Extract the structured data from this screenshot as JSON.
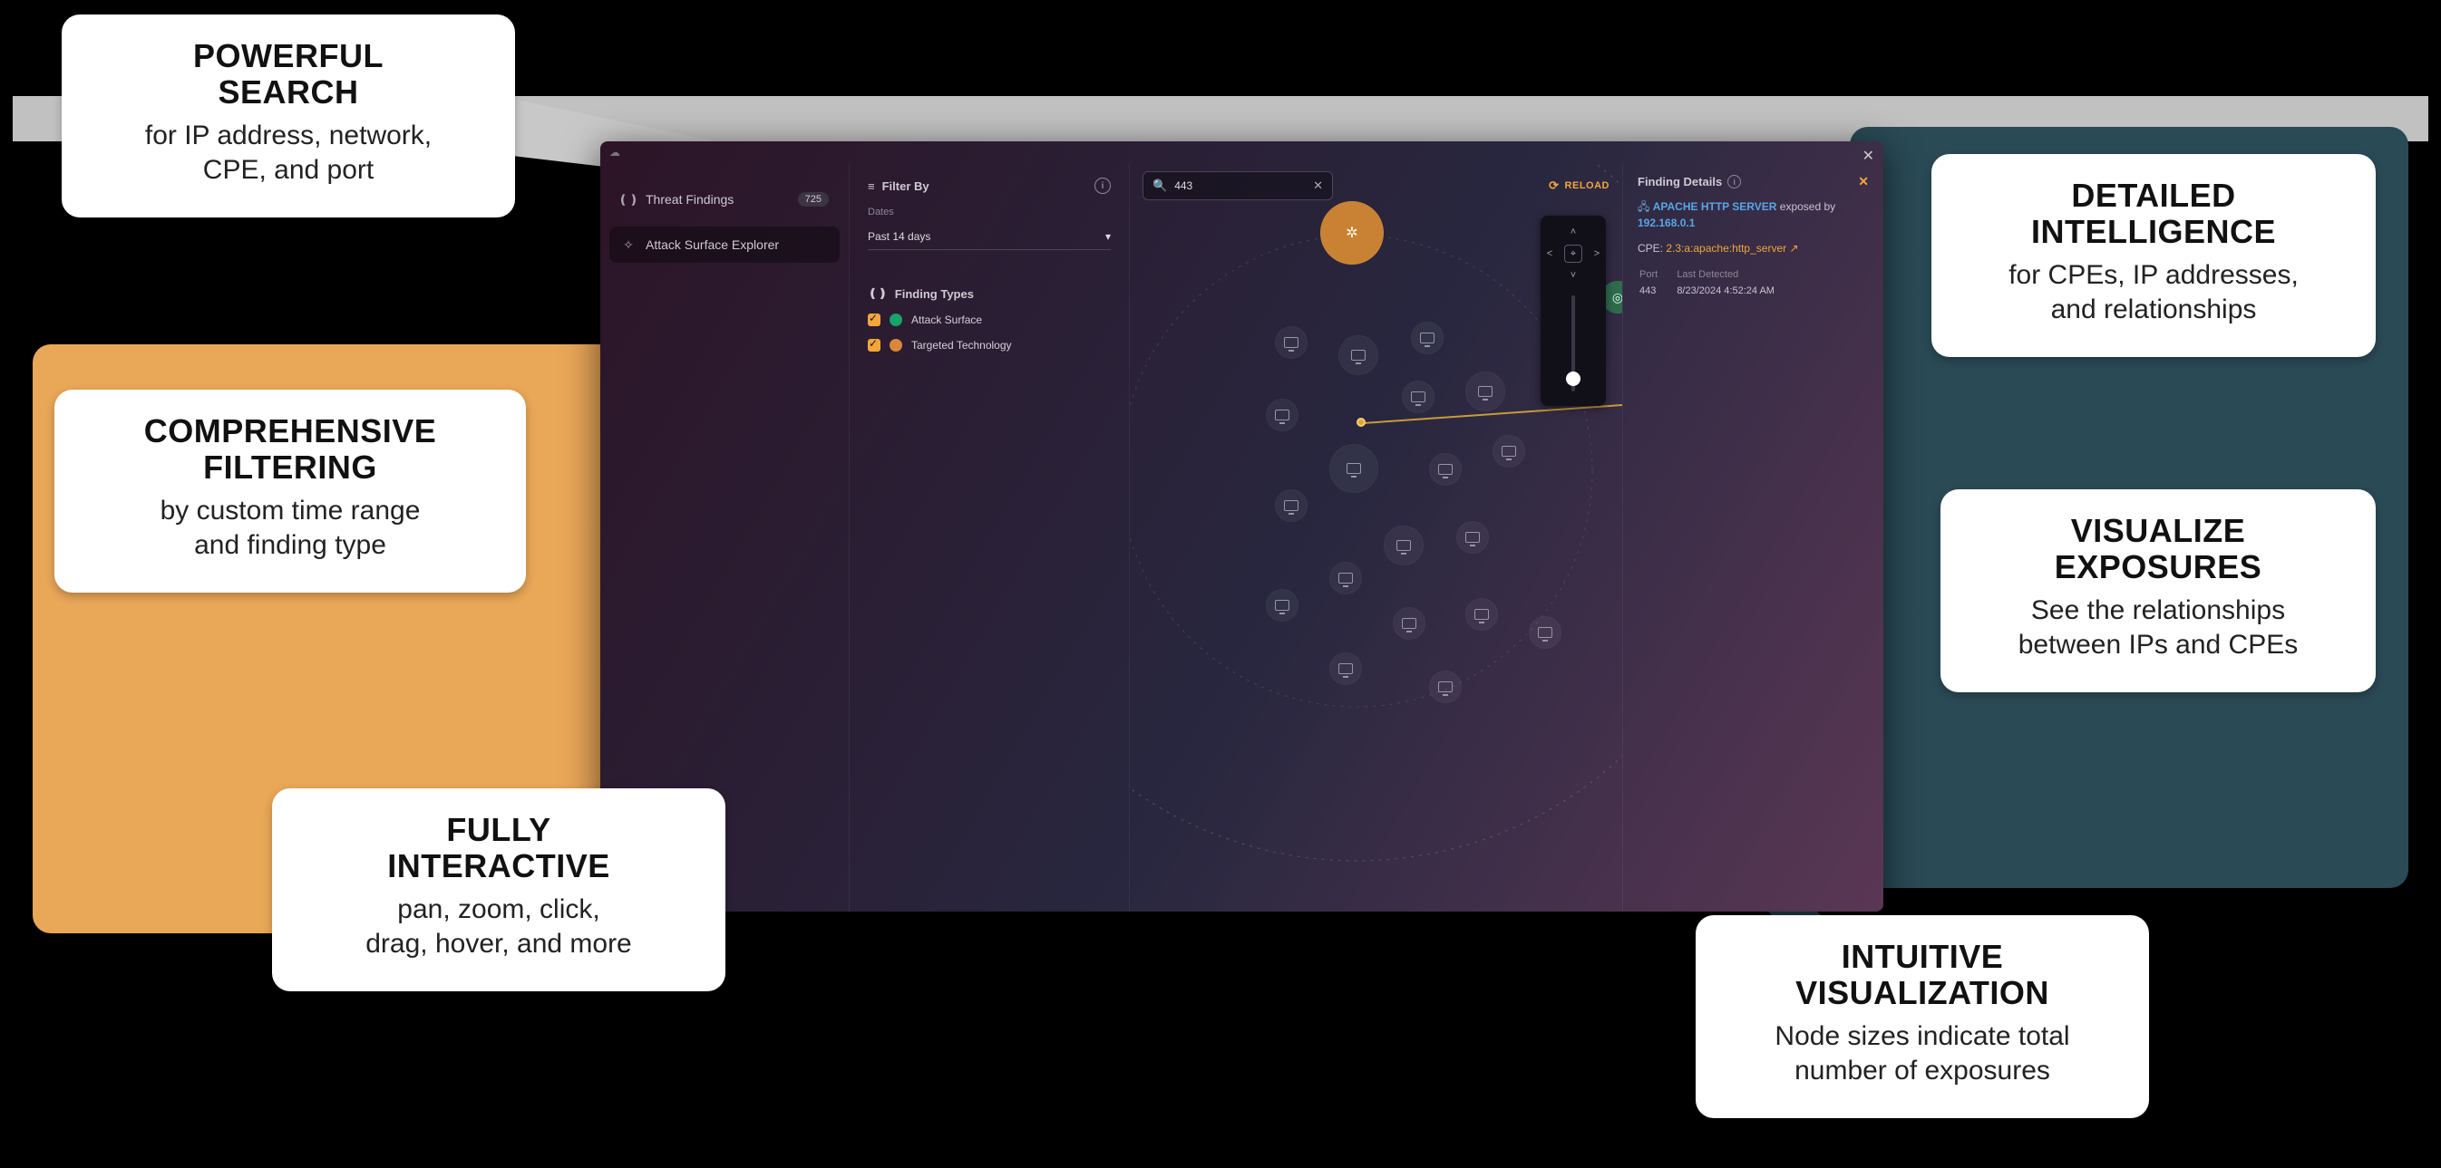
{
  "callouts": {
    "search": {
      "title1": "POWERFUL",
      "title2": "SEARCH",
      "desc": "for IP address, network,\nCPE, and port"
    },
    "filter": {
      "title1": "COMPREHENSIVE",
      "title2": "FILTERING",
      "desc": "by custom time range\nand finding type"
    },
    "interact": {
      "title1": "FULLY",
      "title2": "INTERACTIVE",
      "desc": "pan, zoom, click,\ndrag, hover, and more"
    },
    "detail": {
      "title1": "DETAILED",
      "title2": "INTELLIGENCE",
      "desc": "for CPEs, IP addresses,\nand relationships"
    },
    "vis": {
      "title1": "VISUALIZE",
      "title2": "EXPOSURES",
      "desc": "See the relationships\nbetween IPs and CPEs"
    },
    "intuit": {
      "title1": "INTUITIVE",
      "title2": "VISUALIZATION",
      "desc": "Node sizes indicate total\nnumber of exposures"
    }
  },
  "nav": {
    "threat": {
      "label": "Threat Findings",
      "count": "725"
    },
    "explorer": {
      "label": "Attack Surface Explorer"
    }
  },
  "filter": {
    "header": "Filter By",
    "dates_label": "Dates",
    "dates_value": "Past 14 days",
    "types_header": "Finding Types",
    "type1": "Attack Surface",
    "type2": "Targeted Technology"
  },
  "search": {
    "value": "443"
  },
  "reload": {
    "label": "RELOAD"
  },
  "details": {
    "header": "Finding Details",
    "product": "APACHE HTTP SERVER",
    "exposed_by": "exposed by",
    "ip": "192.168.0.1",
    "cpe_label": "CPE:",
    "cpe_value": "2.3:a:apache:http_server",
    "port_h": "Port",
    "last_h": "Last Detected",
    "port_v": "443",
    "last_v": "8/23/2024 4:52:24 AM"
  }
}
